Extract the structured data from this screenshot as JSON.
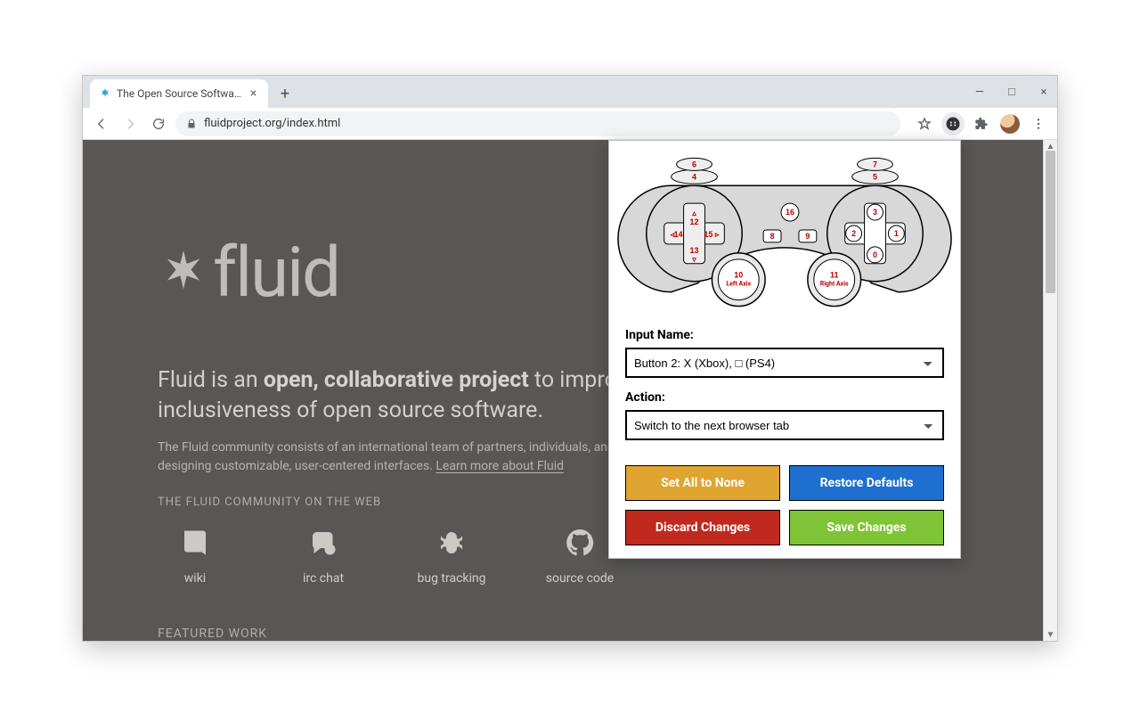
{
  "browser": {
    "tab_title": "The Open Source Software Comm",
    "url": "fluidproject.org/index.html"
  },
  "page": {
    "logo_text": "fluid",
    "headline_prefix": "Fluid is an ",
    "headline_bold": "open, collaborative project",
    "headline_suffix": " to improve the user experience and inclusiveness of open source software.",
    "subtext_main": "The Fluid community consists of an international team of partners, individuals, and institutions focused on designing customizable, user-centered interfaces. ",
    "subtext_link": "Learn more about Fluid",
    "community_label": "THE FLUID COMMUNITY ON THE WEB",
    "icons": {
      "wiki": "wiki",
      "irc": "irc chat",
      "bug": "bug tracking",
      "source": "source code"
    },
    "featured_label": "FEATURED WORK"
  },
  "gamepad": {
    "b0": "0",
    "b1": "1",
    "b2": "2",
    "b3": "3",
    "b4": "4",
    "b5": "5",
    "b6": "6",
    "b7": "7",
    "b8": "8",
    "b9": "9",
    "b12": "12",
    "b13": "13",
    "b14": "14",
    "b15": "15",
    "b16": "16",
    "b10": "10",
    "b10_sub": "Left Axis",
    "b11": "11",
    "b11_sub": "Right Axis"
  },
  "popup": {
    "input_name_label": "Input Name:",
    "input_name_value": "Button 2: X (Xbox), □ (PS4)",
    "action_label": "Action:",
    "action_value": "Switch to the next browser tab",
    "buttons": {
      "set_none": "Set All to None",
      "restore": "Restore Defaults",
      "discard": "Discard Changes",
      "save": "Save Changes"
    }
  }
}
